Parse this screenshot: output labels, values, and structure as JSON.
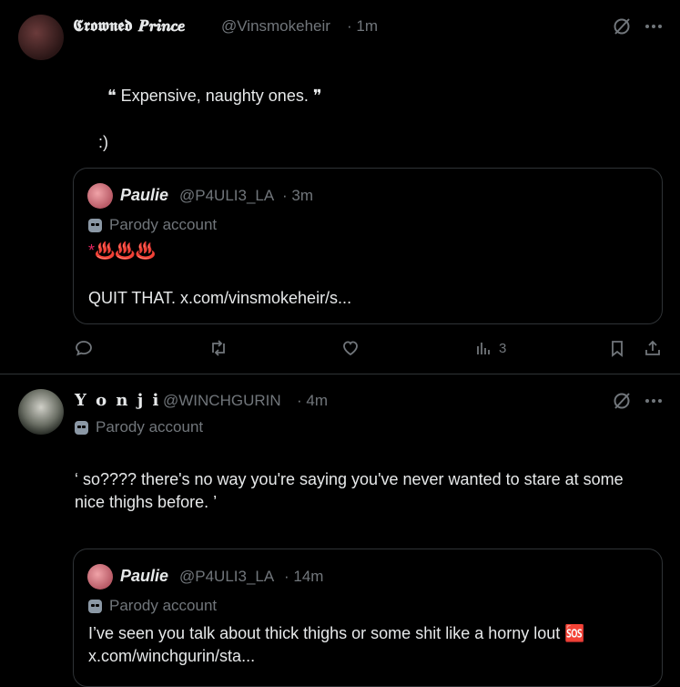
{
  "post1": {
    "display_name": "𝕮𝖗𝖔𝖜𝖓𝖊𝖉 𝑷𝒓𝒊𝒏𝒄𝒆",
    "handle": "@Vinsmokeheir",
    "time": "· 1m",
    "line1": "❝ Expensive, naughty ones. ❞",
    "line2": ":)",
    "quote": {
      "display_name": "Paulie",
      "handle": "@P4ULI3_LA",
      "time": "· 3m",
      "parody": "Parody account",
      "line1": "*♨️♨️♨️",
      "line2": "QUIT THAT. x.com/vinsmokeheir/s..."
    },
    "actions": {
      "views": "3"
    }
  },
  "post2": {
    "display_name": "𝐘 𝐨 𝐧 𝐣 𝐢",
    "handle": "@WINCHGURIN",
    "time": "· 4m",
    "parody": "Parody account",
    "text_line1": "‘  so????  there's no way you're saying you've never wanted to stare at some",
    "text_line2": "nice thighs before.  ’",
    "quote": {
      "display_name": "Paulie",
      "handle": "@P4ULI3_LA",
      "time": "· 14m",
      "parody": "Parody account",
      "line1": "I’ve  seen you talk about thick thighs or some shit like a horny lout 🆘",
      "line2": "x.com/winchgurin/sta..."
    }
  },
  "colors": {
    "background": "#000000",
    "text": "#e7e9ea",
    "secondary": "#71767b",
    "border": "#2f3336"
  }
}
